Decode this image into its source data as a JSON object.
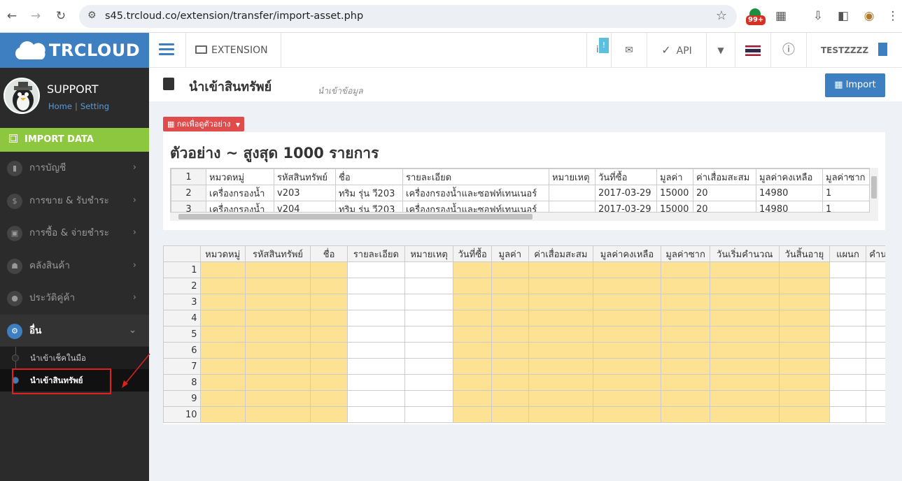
{
  "browser": {
    "url": "s45.trcloud.co/extension/transfer/import-asset.php",
    "ext_badge": "99+"
  },
  "brand": {
    "logo_text": "TRCLOUD"
  },
  "topbar": {
    "menu_extension": "EXTENSION",
    "api_label": "API",
    "notice_badge": "!",
    "user_name": "TESTZZZZ"
  },
  "sidebar": {
    "profile_name": "SUPPORT",
    "home_link": "Home",
    "setting_link": "Setting",
    "section_title": "IMPORT DATA",
    "items": [
      {
        "label": "การบัญชี",
        "icon": "book-icon"
      },
      {
        "label": "การขาย & รับชำระ",
        "icon": "dollar-icon"
      },
      {
        "label": "การซื้อ & จ่ายชำระ",
        "icon": "cart-icon"
      },
      {
        "label": "คลังสินค้า",
        "icon": "cubes-icon"
      },
      {
        "label": "ประวัติคู่ค้า",
        "icon": "user-icon"
      },
      {
        "label": "อื่น",
        "icon": "gear-icon"
      }
    ],
    "sub_items": [
      "นำเข้าเช็คในมือ",
      "นำเข้าสินทรัพย์"
    ]
  },
  "page": {
    "title": "นำเข้าสินทรัพย์",
    "subtitle": "นำเข้าข้อมูล",
    "import_button": "Import",
    "demo_button": "กดเพื่อดูตัวอย่าง",
    "sample_title": "ตัวอย่าง ~ สูงสุด 1000 รายการ"
  },
  "sample_table": {
    "rows": [
      {
        "n": "1",
        "cells": [
          "หมวดหมู่",
          "รหัสสินทรัพย์",
          "ชื่อ",
          "รายละเอียด",
          "หมายเหตุ",
          "วันที่ซื้อ",
          "มูลค่า",
          "ค่าเสื่อมสะสม",
          "มูลค่าคงเหลือ",
          "มูลค่าซาก"
        ]
      },
      {
        "n": "2",
        "cells": [
          "เครื่องกรองน้ำ",
          "v203",
          "ทริม รุ่น วี203",
          "เครื่องกรองน้ำและซอฟท์เทนเนอร์",
          "",
          "2017-03-29",
          "15000",
          "20",
          "14980",
          "1"
        ]
      },
      {
        "n": "3",
        "cells": [
          "เครื่องกรองน้ำ",
          "v204",
          "ทริม รุ่น วี203",
          "เครื่องกรองน้ำและซอฟท์เทนเนอร์",
          "",
          "2017-03-29",
          "15000",
          "20",
          "14980",
          "1"
        ]
      }
    ]
  },
  "input_table": {
    "headers": [
      "หมวดหมู่",
      "รหัสสินทรัพย์",
      "ชื่อ",
      "รายละเอียด",
      "หมายเหตุ",
      "วันที่ซื้อ",
      "มูลค่า",
      "ค่าเสื่อมสะสม",
      "มูลค่าคงเหลือ",
      "มูลค่าซาก",
      "วันเริ่มคำนวณ",
      "วันสิ้นอายุ",
      "แผนก",
      "คำนวณค่าเสื่อม"
    ],
    "row_numbers": [
      "1",
      "2",
      "3",
      "4",
      "5",
      "6",
      "7",
      "8",
      "9",
      "10"
    ],
    "required_columns": [
      true,
      true,
      true,
      false,
      false,
      true,
      true,
      true,
      true,
      true,
      true,
      true,
      false,
      false
    ],
    "required_color": "#fde293"
  }
}
